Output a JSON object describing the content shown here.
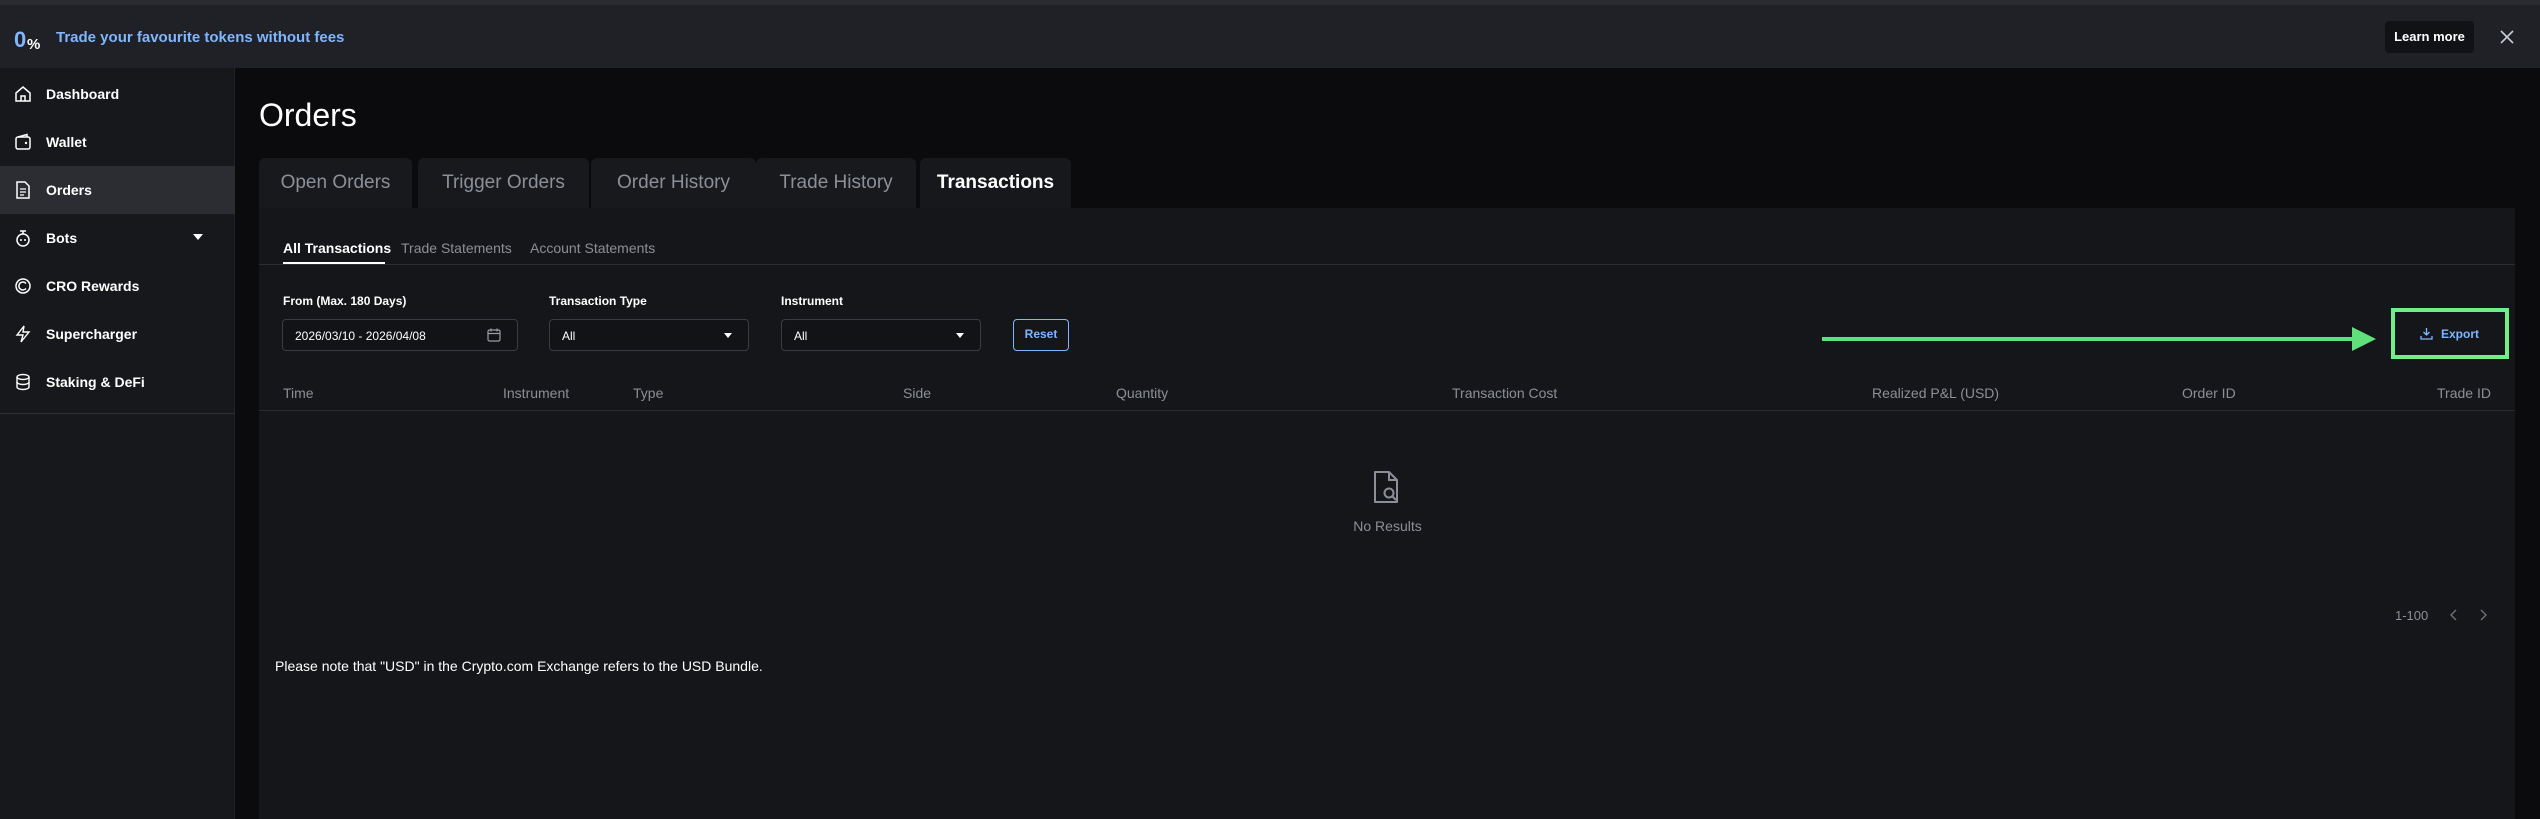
{
  "banner": {
    "logo_text": "0%",
    "message": "Trade your favourite tokens without fees",
    "learn_more": "Learn more",
    "close_icon": "close-icon"
  },
  "sidebar": {
    "items": [
      {
        "label": "Dashboard",
        "icon": "home-icon",
        "active": false
      },
      {
        "label": "Wallet",
        "icon": "wallet-icon",
        "active": false
      },
      {
        "label": "Orders",
        "icon": "document-icon",
        "active": true
      },
      {
        "label": "Bots",
        "icon": "bot-icon",
        "active": false,
        "has_dropdown": true
      },
      {
        "label": "CRO Rewards",
        "icon": "rewards-icon",
        "active": false
      },
      {
        "label": "Supercharger",
        "icon": "lightning-icon",
        "active": false
      },
      {
        "label": "Staking & DeFi",
        "icon": "coins-icon",
        "active": false
      }
    ]
  },
  "page": {
    "title": "Orders"
  },
  "tabs": [
    {
      "label": "Open Orders",
      "active": false
    },
    {
      "label": "Trigger Orders",
      "active": false
    },
    {
      "label": "Order History",
      "active": false
    },
    {
      "label": "Trade History",
      "active": false
    },
    {
      "label": "Transactions",
      "active": true
    }
  ],
  "subtabs": [
    {
      "label": "All Transactions",
      "active": true
    },
    {
      "label": "Trade Statements",
      "active": false
    },
    {
      "label": "Account Statements",
      "active": false
    }
  ],
  "filters": {
    "date_label": "From (Max. 180 Days)",
    "date_value": "2026/03/10 - 2026/04/08",
    "type_label": "Transaction Type",
    "type_value": "All",
    "instrument_label": "Instrument",
    "instrument_value": "All",
    "reset": "Reset"
  },
  "export": {
    "label": "Export",
    "icon": "download-icon"
  },
  "table": {
    "columns": [
      "Time",
      "Instrument",
      "Type",
      "Side",
      "Quantity",
      "Transaction Cost",
      "Realized P&L (USD)",
      "Order ID",
      "Trade ID"
    ],
    "rows": [],
    "empty_text": "No Results"
  },
  "pagination": {
    "range": "1-100"
  },
  "footnote": "Please note that \"USD\" in the Crypto.com Exchange refers to the USD Bundle.",
  "colors": {
    "accent": "#7fb6ff",
    "highlight": "#6fee8a",
    "background": "#0b0b0d",
    "panel": "#151619"
  }
}
